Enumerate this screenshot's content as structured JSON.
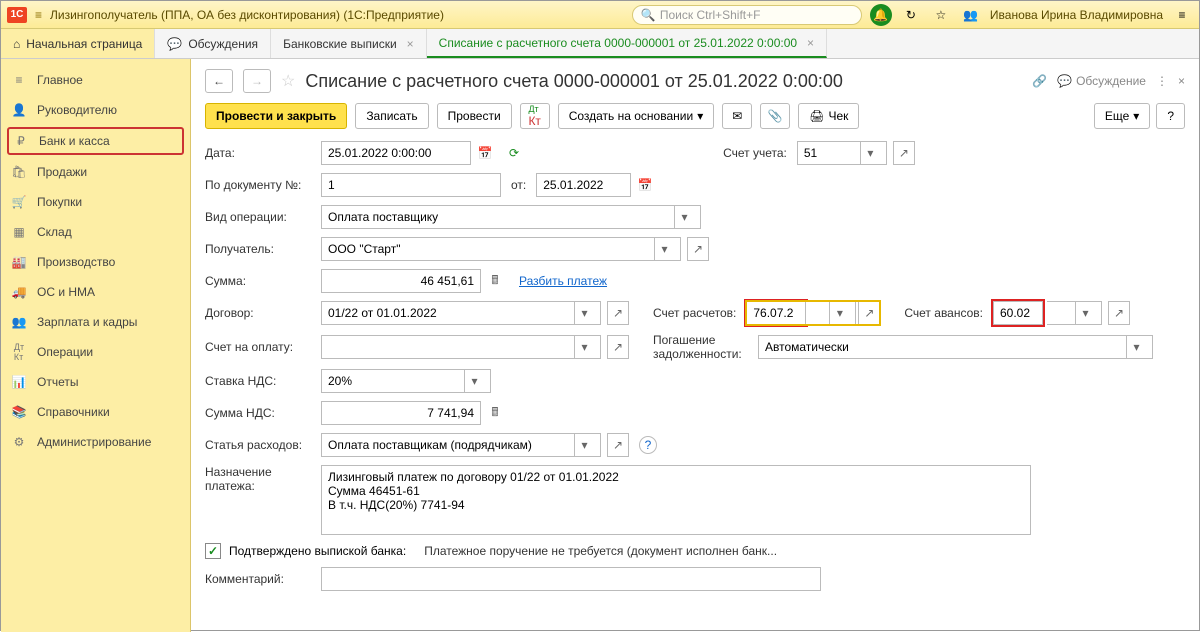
{
  "titlebar": {
    "app_title": "Лизингополучатель (ППА, ОА без дисконтирования)  (1С:Предприятие)",
    "search_placeholder": "Поиск Ctrl+Shift+F",
    "user": "Иванова Ирина Владимировна"
  },
  "tabs": {
    "home": "Начальная страница",
    "discuss": "Обсуждения",
    "bank": "Банковские выписки",
    "active": "Списание с расчетного счета 0000-000001 от 25.01.2022 0:00:00"
  },
  "sidebar": [
    "Главное",
    "Руководителю",
    "Банк и касса",
    "Продажи",
    "Покупки",
    "Склад",
    "Производство",
    "ОС и НМА",
    "Зарплата и кадры",
    "Операции",
    "Отчеты",
    "Справочники",
    "Администрирование"
  ],
  "doc": {
    "title": "Списание с расчетного счета 0000-000001 от 25.01.2022 0:00:00",
    "discuss_btn": "Обсуждение"
  },
  "toolbar": {
    "post_close": "Провести и закрыть",
    "save": "Записать",
    "post": "Провести",
    "create": "Создать на основании",
    "check": "Чек",
    "more": "Еще",
    "help": "?"
  },
  "form": {
    "date_lbl": "Дата:",
    "date": "25.01.2022  0:00:00",
    "acct_lbl": "Счет учета:",
    "acct": "51",
    "docnum_lbl": "По документу №:",
    "docnum": "1",
    "from_lbl": "от:",
    "docnum_date": "25.01.2022",
    "op_lbl": "Вид операции:",
    "op": "Оплата поставщику",
    "payee_lbl": "Получатель:",
    "payee": "ООО \"Старт\"",
    "sum_lbl": "Сумма:",
    "sum": "46 451,61",
    "split": "Разбить платеж",
    "dog_lbl": "Договор:",
    "dog": "01/22 от 01.01.2022",
    "calc_lbl": "Счет расчетов:",
    "calc": "76.07.2",
    "adv_lbl": "Счет авансов:",
    "adv": "60.02",
    "pay_lbl": "Счет на оплату:",
    "debt_lbl": "Погашение задолженности:",
    "debt": "Автоматически",
    "vat_lbl": "Ставка НДС:",
    "vat": "20%",
    "vatsum_lbl": "Сумма НДС:",
    "vatsum": "7 741,94",
    "exp_lbl": "Статья расходов:",
    "exp": "Оплата поставщикам (подрядчикам)",
    "purpose_lbl": "Назначение платежа:",
    "purpose": "Лизинговый платеж по договору 01/22 от 01.01.2022\nСумма 46451-61\nВ т.ч. НДС(20%) 7741-94",
    "confirm_lbl": "Подтверждено выпиской банка:",
    "confirm_txt": "Платежное поручение не требуется (документ исполнен банк...",
    "comment_lbl": "Комментарий:"
  }
}
